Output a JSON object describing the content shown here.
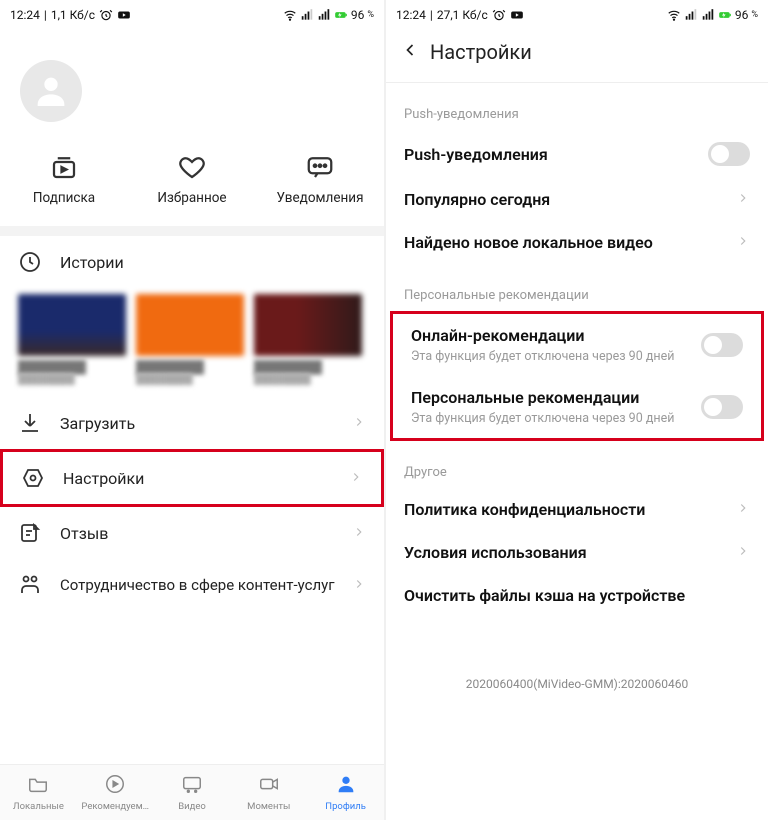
{
  "left": {
    "status": {
      "time": "12:24",
      "speed": "1,1 Кб/с",
      "battery": "96",
      "battery_pct": "%"
    },
    "tabs": {
      "subscribe": "Подписка",
      "favorites": "Избранное",
      "notifications": "Уведомления"
    },
    "rows": {
      "history": "Истории",
      "download": "Загрузить",
      "settings": "Настройки",
      "feedback": "Отзыв",
      "cooperation": "Сотрудничество в сфере контент-услуг"
    },
    "nav": {
      "local": "Локальные",
      "recommend": "Рекомендуем…",
      "video": "Видео",
      "moments": "Моменты",
      "profile": "Профиль"
    }
  },
  "right": {
    "status": {
      "time": "12:24",
      "speed": "27,1 Кб/с",
      "battery": "96",
      "battery_pct": "%"
    },
    "header_title": "Настройки",
    "sec_push": "Push-уведомления",
    "rows": {
      "push": "Push-уведомления",
      "popular": "Популярно сегодня",
      "newlocal": "Найдено новое локальное видео"
    },
    "sec_pers": "Персональные рекомендации",
    "online": {
      "t": "Онлайн-рекомендации",
      "s": "Эта функция будет отключена через 90 дней"
    },
    "personal": {
      "t": "Персональные рекомендации",
      "s": "Эта функция будет отключена через 90 дней"
    },
    "sec_other": "Другое",
    "other": {
      "privacy": "Политика конфиденциальности",
      "terms": "Условия использования",
      "clear": "Очистить файлы кэша на устройстве"
    },
    "build": "2020060400(MiVideo-GMM):2020060460"
  }
}
